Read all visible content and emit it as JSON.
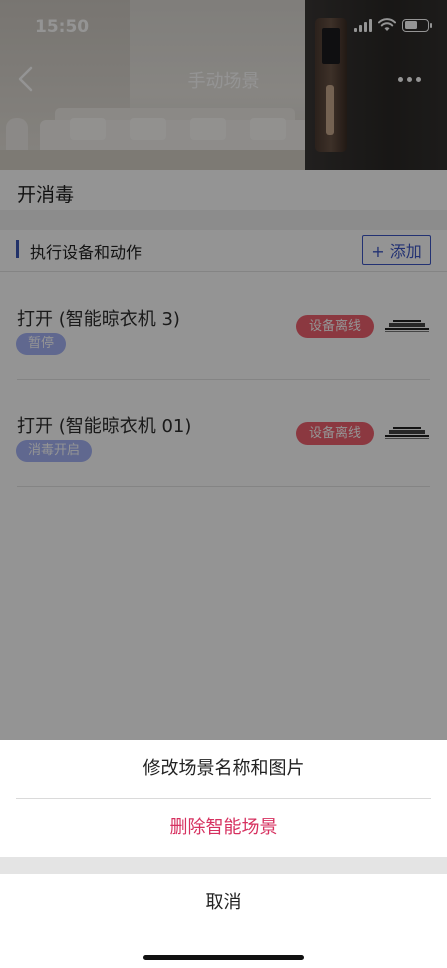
{
  "status_bar": {
    "time": "15:50"
  },
  "nav": {
    "title": "手动场景",
    "back_icon": "back-arrow-icon",
    "more_icon": "more-dots-icon"
  },
  "scene": {
    "name": "开消毒"
  },
  "section": {
    "title": "执行设备和动作",
    "add_label": "+ 添加"
  },
  "devices": [
    {
      "action": "打开 (智能晾衣机 3)",
      "tag": "暂停",
      "status": "设备离线",
      "icon": "clothes-dryer-icon"
    },
    {
      "action": "打开 (智能晾衣机 01)",
      "tag": "消毒开启",
      "status": "设备离线",
      "icon": "clothes-dryer-icon"
    }
  ],
  "sheet": {
    "edit_label": "修改场景名称和图片",
    "delete_label": "删除智能场景",
    "cancel_label": "取消"
  },
  "colors": {
    "accent": "#3d56c6",
    "offline": "#f0616f",
    "tag": "#a5b3f7",
    "danger": "#d6305f"
  }
}
